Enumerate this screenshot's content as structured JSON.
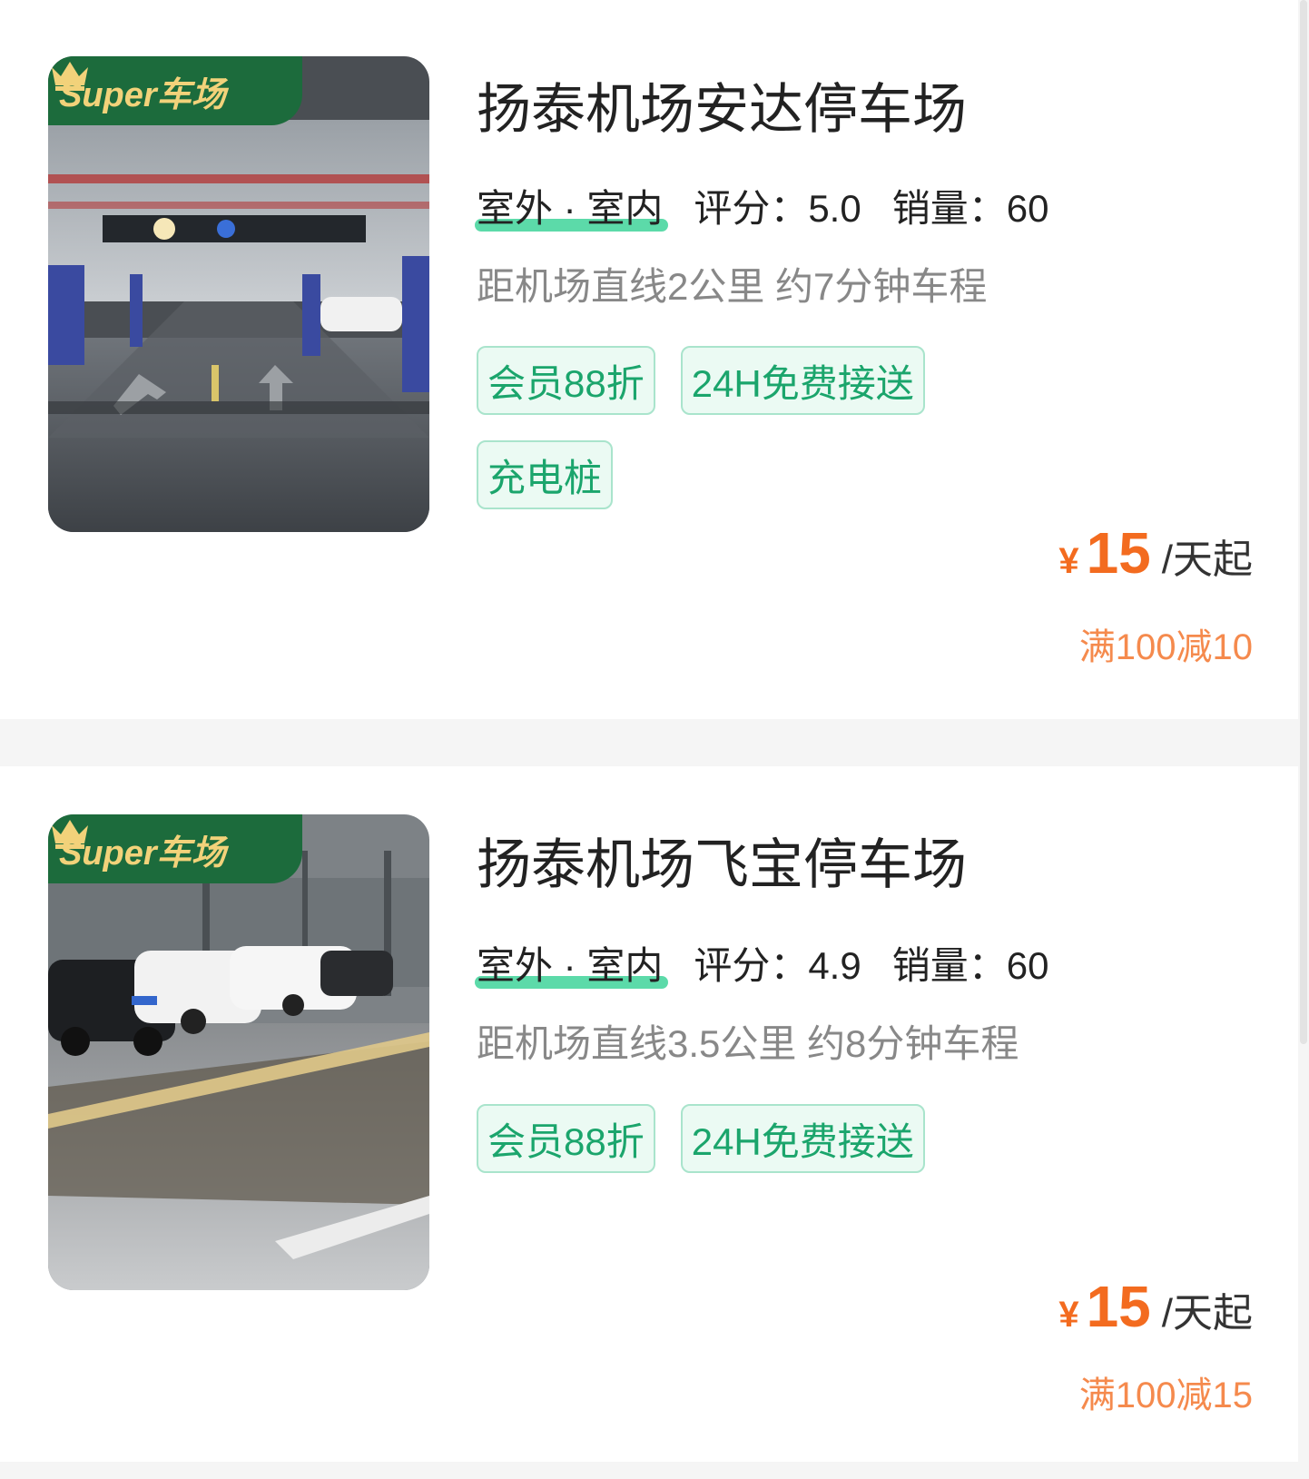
{
  "listings": [
    {
      "badge": "Super车场",
      "title": "扬泰机场安达停车场",
      "type": "室外 · 室内",
      "rating": "评分：5.0",
      "sales": "销量：60",
      "distance": "距机场直线2公里 约7分钟车程",
      "tags": [
        "会员88折",
        "24H免费接送",
        "充电桩"
      ],
      "currency": "¥",
      "price": "15",
      "unit": "/天起",
      "promo": "满100减10"
    },
    {
      "badge": "Super车场",
      "title": "扬泰机场飞宝停车场",
      "type": "室外 · 室内",
      "rating": "评分：4.9",
      "sales": "销量：60",
      "distance": "距机场直线3.5公里 约8分钟车程",
      "tags": [
        "会员88折",
        "24H免费接送"
      ],
      "currency": "¥",
      "price": "15",
      "unit": "/天起",
      "promo": "满100减15"
    }
  ],
  "colors": {
    "accent_green": "#1ba56c",
    "price_orange": "#f36b1f",
    "badge_green": "#1c6b3c",
    "badge_gold": "#f2d27a"
  },
  "icons": [
    "crown-icon"
  ]
}
